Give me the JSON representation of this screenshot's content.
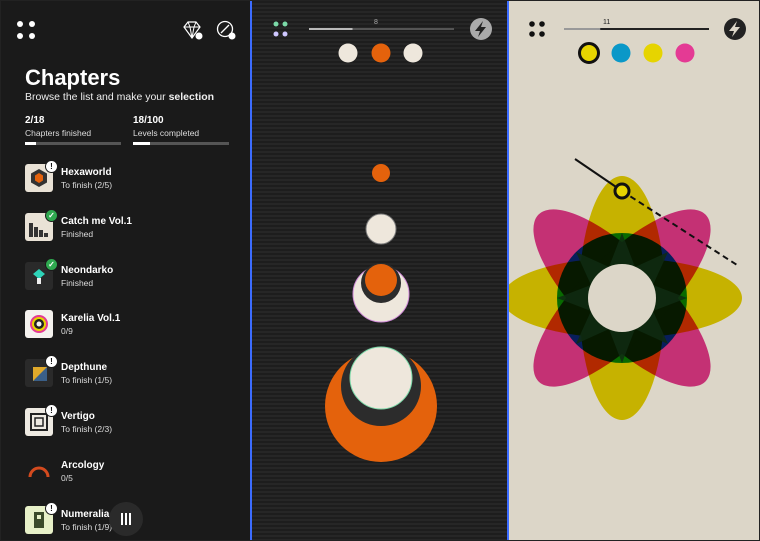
{
  "chapters_panel": {
    "title": "Chapters",
    "subtitle_prefix": "Browse the list and make your ",
    "subtitle_bold": "selection",
    "stats": [
      {
        "value": "2/18",
        "label": "Chapters finished",
        "progress": 0.11
      },
      {
        "value": "18/100",
        "label": "Levels completed",
        "progress": 0.18
      }
    ],
    "chapters": [
      {
        "name": "Hexaworld",
        "status": "To finish (2/5)",
        "badge": "warn",
        "thumb": "hexaworld"
      },
      {
        "name": "Catch me Vol.1",
        "status": "Finished",
        "badge": "ok",
        "thumb": "catchme"
      },
      {
        "name": "Neondarko",
        "status": "Finished",
        "badge": "ok",
        "thumb": "neondarko"
      },
      {
        "name": "Karelia Vol.1",
        "status": "0/9",
        "badge": "",
        "thumb": "karelia"
      },
      {
        "name": "Depthune",
        "status": "To finish (1/5)",
        "badge": "warn",
        "thumb": "depthune"
      },
      {
        "name": "Vertigo",
        "status": "To finish (2/3)",
        "badge": "warn",
        "thumb": "vertigo"
      },
      {
        "name": "Arcology",
        "status": "0/5",
        "badge": "",
        "thumb": "arcology"
      },
      {
        "name": "Numeralia",
        "status": "To finish (1/9)",
        "badge": "warn",
        "thumb": "numeralia"
      }
    ],
    "icons": {
      "menu": "menu-grid-icon",
      "diamond": "diamond-icon",
      "settings": "compass-icon",
      "pause": "pause-icon"
    },
    "badge_symbols": {
      "warn": "!",
      "ok": "✓"
    }
  },
  "middle_level": {
    "level_number": "8",
    "progress": 0.3,
    "colors": {
      "orange": "#e4620c",
      "cream": "#eee7dc",
      "ring": "#2c2c2c"
    },
    "swatches": [
      "cream",
      "orange",
      "cream"
    ],
    "icons": {
      "menu": "menu-grid-icon",
      "hint": "lightning-icon"
    }
  },
  "right_level": {
    "level_number": "11",
    "progress": 0.25,
    "colors": {
      "yellow": "#e6d400",
      "cyan": "#0a98c8",
      "magenta": "#e43a94",
      "green": "#00a035",
      "blue": "#1740a8",
      "dark": "#0f2b12",
      "paper": "#dcd6c8"
    },
    "swatches": [
      "yellow",
      "cyan",
      "yellow",
      "magenta"
    ],
    "icons": {
      "menu": "menu-grid-icon",
      "hint": "lightning-icon"
    }
  }
}
